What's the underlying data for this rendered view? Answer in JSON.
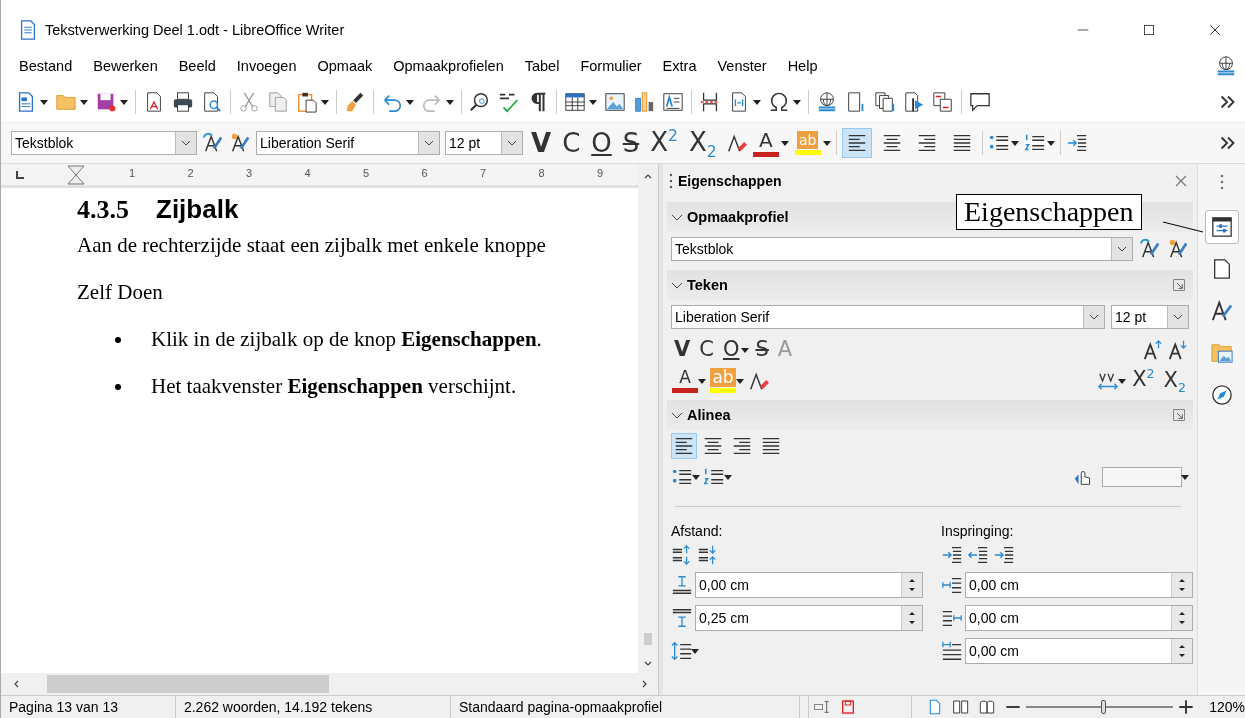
{
  "window": {
    "title": "Tekstverwerking Deel 1.odt - LibreOffice Writer"
  },
  "menu": [
    "Bestand",
    "Bewerken",
    "Beeld",
    "Invoegen",
    "Opmaak",
    "Opmaakprofielen",
    "Tabel",
    "Formulier",
    "Extra",
    "Venster",
    "Help"
  ],
  "formatting_toolbar": {
    "paragraph_style": "Tekstblok",
    "font_name": "Liberation Serif",
    "font_size": "12 pt",
    "format_buttons": [
      {
        "label": "V",
        "kind": "bold"
      },
      {
        "label": "C",
        "kind": "italic"
      },
      {
        "label": "O",
        "kind": "underline"
      },
      {
        "label": "S",
        "kind": "strike"
      },
      {
        "label": "X$^{2}$",
        "kind": "superscript"
      },
      {
        "label": "X$_{2}$",
        "kind": "subscript"
      }
    ],
    "color_buttons": [
      {
        "label": "A",
        "kind": "font-color",
        "color": "#c9211e"
      },
      {
        "label": "ab",
        "kind": "highlight",
        "color": "#ffff00"
      }
    ],
    "align_buttons": [
      {
        "selected": true
      },
      {
        "selected": false
      },
      {
        "selected": false
      },
      {
        "selected": false
      }
    ]
  },
  "ruler": {
    "labels": [
      "1",
      "2",
      "3",
      "4",
      "5",
      "6",
      "7",
      "8",
      "9"
    ]
  },
  "document": {
    "heading_number": "4.3.5",
    "heading": "Zijbalk",
    "paragraph": "Aan de rechterzijde staat een zijbalk met enkele knoppe",
    "subheading": "Zelf Doen",
    "bullets": [
      "Klik in de zijbalk op de knop **Eigenschappen**.",
      "Het taakvenster **Eigenschappen** verschijnt."
    ]
  },
  "sidebar": {
    "title": "Eigenschappen",
    "style_section": {
      "title": "Opmaakprofiel",
      "expanded": true,
      "style": "Tekstblok"
    },
    "character_section": {
      "title": "Teken",
      "expanded": true,
      "font": "Liberation Serif",
      "size": "12 pt",
      "format_buttons": [
        {
          "label": "V",
          "kind": "bold"
        },
        {
          "label": "C",
          "kind": "italic"
        },
        {
          "label": "O",
          "kind": "underline"
        },
        {
          "label": "S",
          "kind": "strike"
        },
        {
          "label": "A",
          "kind": "shadow"
        }
      ],
      "color_buttons": [
        {
          "label": "A",
          "kind": "font-color",
          "color": "#c9211e"
        },
        {
          "label": "ab",
          "kind": "highlight",
          "color": "#ffff00"
        }
      ],
      "script_buttons": [
        {
          "label": "X$^{2}$",
          "kind": "superscript"
        },
        {
          "label": "X$_{2}$",
          "kind": "subscript"
        }
      ]
    },
    "paragraph_section": {
      "title": "Alinea",
      "expanded": true,
      "align_buttons": [
        {
          "selected": true
        },
        {
          "selected": false
        },
        {
          "selected": false
        },
        {
          "selected": false
        }
      ],
      "spacing": {
        "label": "Afstand:",
        "values": [
          "0,00 cm",
          "0,25 cm"
        ]
      },
      "indent": {
        "label": "Inspringing:",
        "values": [
          "0,00 cm",
          "0,00 cm",
          "0,00 cm"
        ]
      }
    }
  },
  "sidebar_tabs": [
    {
      "selected": true
    },
    {
      "selected": false
    },
    {
      "selected": false
    },
    {
      "selected": false
    },
    {
      "selected": false
    }
  ],
  "callout": "Eigenschappen",
  "status_bar": {
    "page": "Pagina 13 van 13",
    "counts": "2.262 woorden, 14.192 tekens",
    "page_style": "Standaard pagina-opmaakprofiel",
    "zoom": {
      "level": 0.53,
      "reading": "120%"
    }
  }
}
